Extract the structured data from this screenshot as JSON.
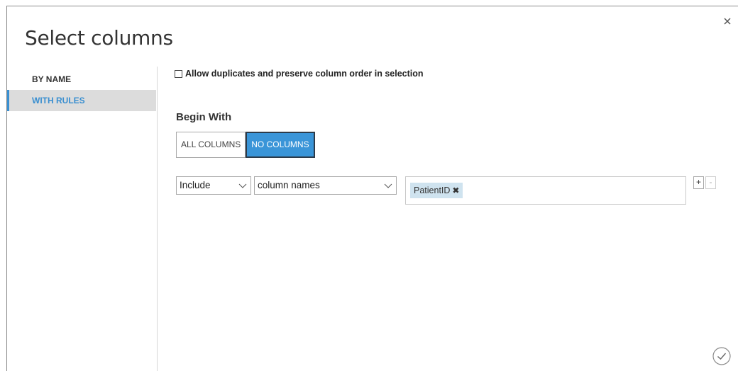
{
  "dialog": {
    "title": "Select columns",
    "close_icon": "close-icon",
    "ok_icon": "checkmark-circle-icon"
  },
  "sidebar": {
    "items": [
      {
        "label": "BY NAME",
        "active": false
      },
      {
        "label": "WITH RULES",
        "active": true
      }
    ]
  },
  "options": {
    "allow_duplicates_label": "Allow duplicates and preserve column order in selection",
    "allow_duplicates_checked": false
  },
  "begin_with": {
    "label": "Begin With",
    "all_columns_label": "ALL COLUMNS",
    "no_columns_label": "NO COLUMNS",
    "selected": "NO COLUMNS"
  },
  "rule": {
    "mode_value": "Include",
    "type_value": "column names",
    "tags": [
      {
        "label": "PatientID"
      }
    ],
    "add_label": "+",
    "remove_label": "-"
  },
  "colors": {
    "accent": "#3a95d8",
    "active_nav_text": "#3a8fd0",
    "tag_bg": "#cfe3ef"
  }
}
